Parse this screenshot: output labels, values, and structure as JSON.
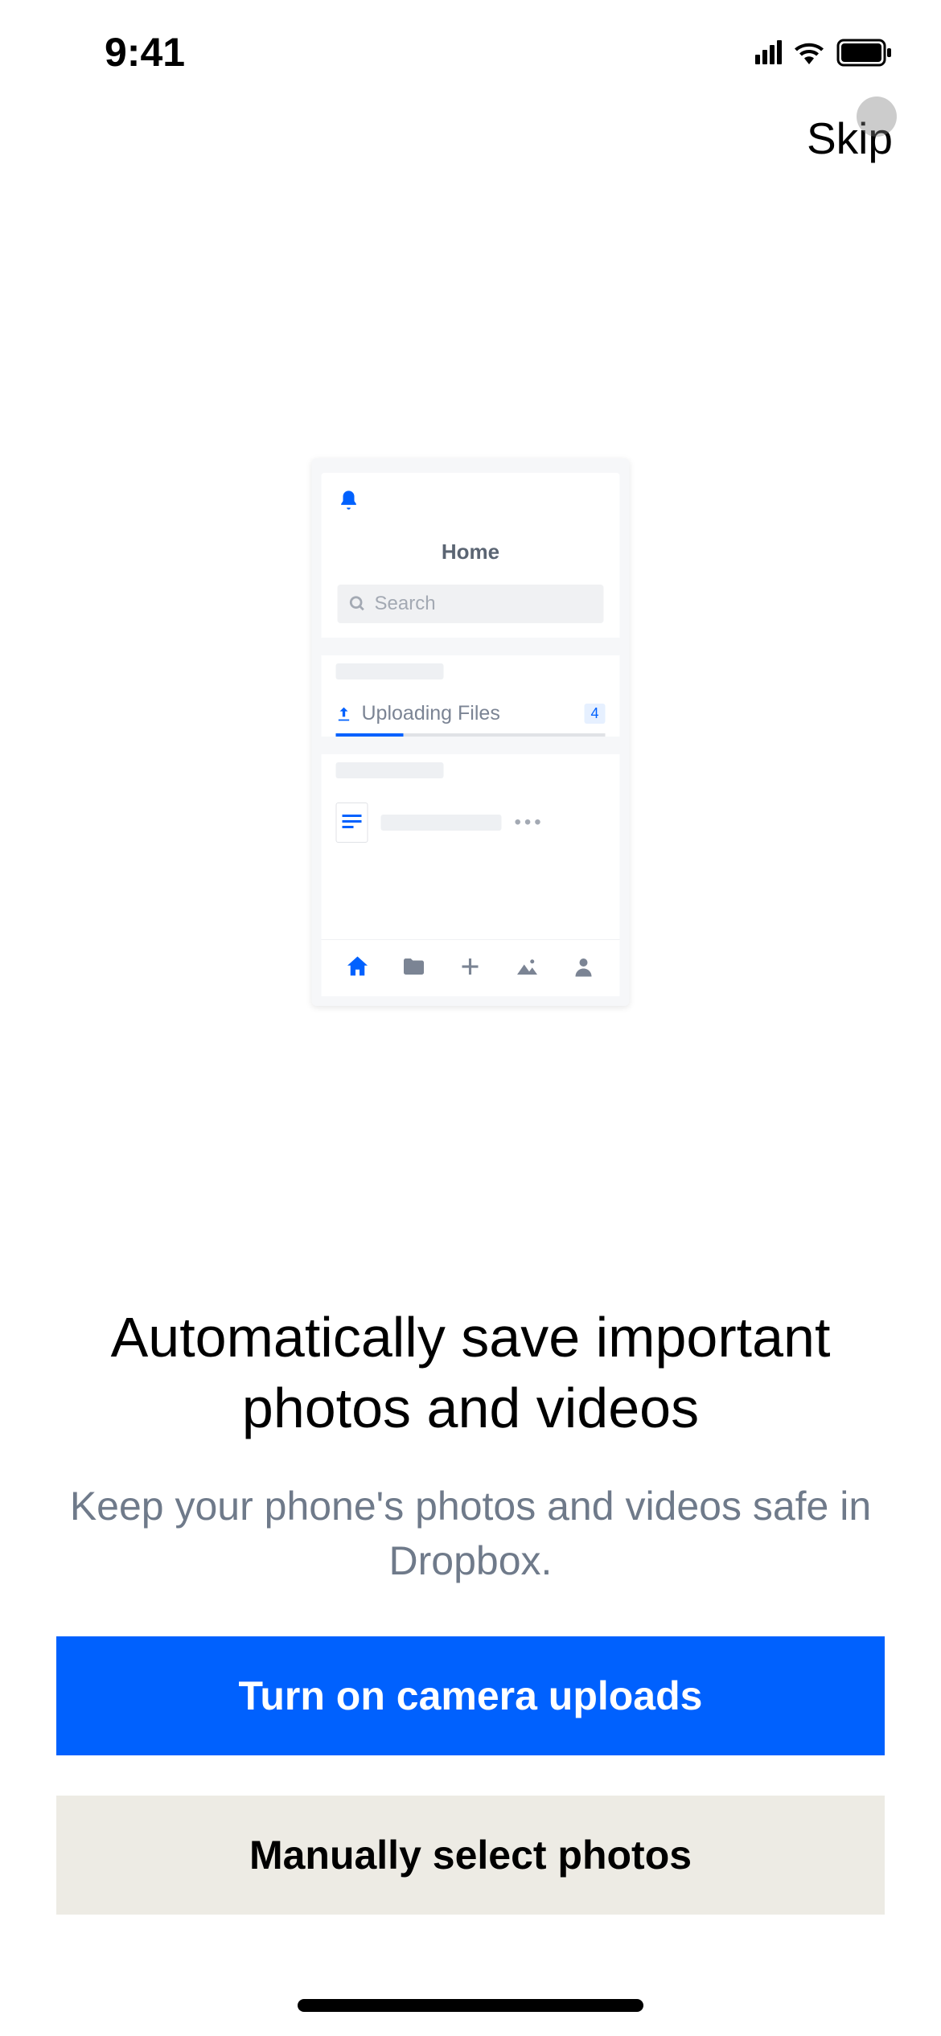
{
  "status_bar": {
    "time": "9:41"
  },
  "header": {
    "skip_label": "Skip"
  },
  "illustration": {
    "home_title": "Home",
    "search_placeholder": "Search",
    "upload_label": "Uploading Files",
    "upload_count": "4"
  },
  "content": {
    "headline": "Automatically save important photos and videos",
    "subtext": "Keep your phone's photos and videos safe in Dropbox.",
    "primary_button": "Turn on camera uploads",
    "secondary_button": "Manually select photos"
  }
}
